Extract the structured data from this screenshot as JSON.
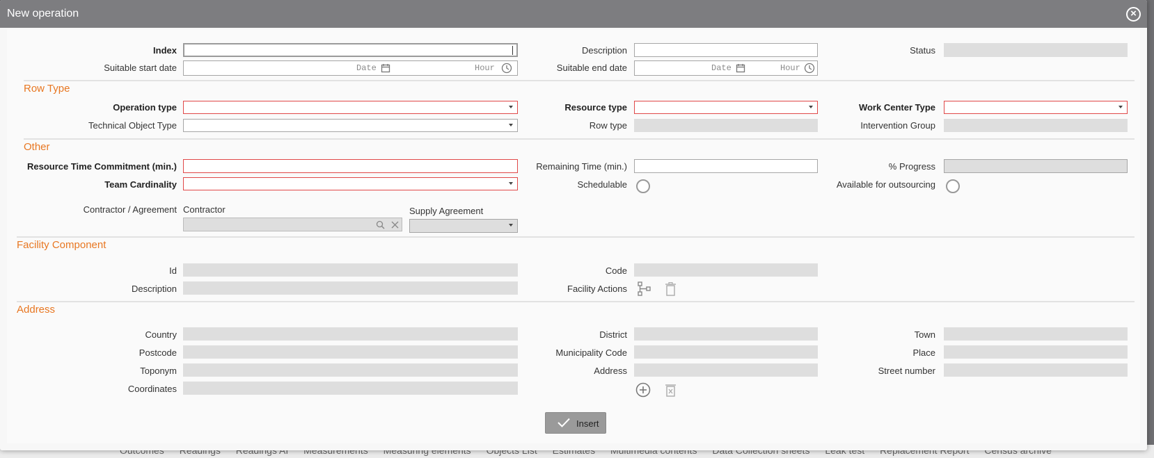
{
  "dialog": {
    "title": "New operation"
  },
  "top": {
    "index_label": "Index",
    "description_label": "Description",
    "status_label": "Status",
    "start_label": "Suitable start date",
    "end_label": "Suitable end date",
    "date_placeholder": "Date",
    "hour_placeholder": "Hour"
  },
  "row_type": {
    "title": "Row Type",
    "operation_type_label": "Operation type",
    "resource_type_label": "Resource type",
    "work_center_type_label": "Work Center Type",
    "technical_object_type_label": "Technical Object Type",
    "row_type_label": "Row type",
    "intervention_group_label": "Intervention Group"
  },
  "other": {
    "title": "Other",
    "resource_time_label": "Resource Time Commitment (min.)",
    "remaining_time_label": "Remaining Time (min.)",
    "progress_label": "% Progress",
    "team_cardinality_label": "Team Cardinality",
    "schedulable_label": "Schedulable",
    "outsourcing_label": "Available for outsourcing",
    "contractor_agreement_label": "Contractor / Agreement",
    "contractor_label": "Contractor",
    "supply_agreement_label": "Supply Agreement"
  },
  "facility": {
    "title": "Facility Component",
    "id_label": "Id",
    "code_label": "Code",
    "description_label": "Description",
    "actions_label": "Facility Actions"
  },
  "address": {
    "title": "Address",
    "country_label": "Country",
    "district_label": "District",
    "town_label": "Town",
    "postcode_label": "Postcode",
    "municipality_label": "Municipality Code",
    "place_label": "Place",
    "toponym_label": "Toponym",
    "address_label": "Address",
    "street_number_label": "Street number",
    "coordinates_label": "Coordinates"
  },
  "footer": {
    "insert_label": "Insert"
  },
  "background": {
    "tabs": [
      "Outcomes",
      "Readings",
      "Readings AI",
      "Measurements",
      "Measuring elements",
      "Objects List",
      "Estimates",
      "Multimedia contents",
      "Data Collection sheets",
      "Leak test",
      "Replacement Report",
      "Census archive"
    ]
  },
  "colors": {
    "accent": "#e87722",
    "required_border": "#e04848",
    "titlebar": "#7d7d80"
  }
}
